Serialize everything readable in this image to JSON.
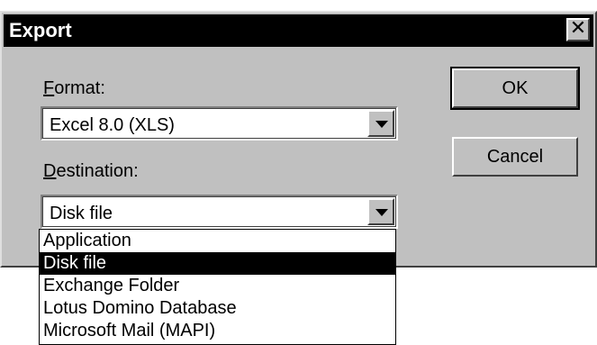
{
  "dialog": {
    "title": "Export",
    "close_glyph": "✕"
  },
  "format": {
    "label_mnemonic": "F",
    "label_rest": "ormat:",
    "value": "Excel 8.0 (XLS)"
  },
  "destination": {
    "label_mnemonic": "D",
    "label_rest": "estination:",
    "value": "Disk file",
    "options": [
      "Application",
      "Disk file",
      "Exchange Folder",
      "Lotus Domino Database",
      "Microsoft Mail (MAPI)"
    ],
    "selected": "Disk file"
  },
  "buttons": {
    "ok": "OK",
    "cancel": "Cancel"
  }
}
